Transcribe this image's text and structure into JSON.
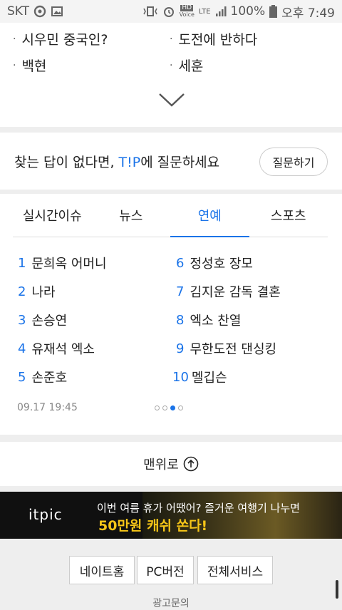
{
  "status_bar": {
    "carrier": "SKT",
    "battery": "100%",
    "time": "오후 7:49",
    "hd_label": "HD",
    "voice_label": "Voice",
    "lte_label": "LTE"
  },
  "related": {
    "items": [
      "시우민 중국인?",
      "도전에 반하다",
      "백현",
      "세훈"
    ]
  },
  "tip_prompt": {
    "prefix": "찾는 답이 없다면, ",
    "brand": "T!P",
    "suffix": "에 질문하세요",
    "button_label": "질문하기"
  },
  "trending": {
    "tabs": [
      {
        "label": "실시간이슈",
        "active": false
      },
      {
        "label": "뉴스",
        "active": false
      },
      {
        "label": "연예",
        "active": true
      },
      {
        "label": "스포츠",
        "active": false
      }
    ],
    "items": [
      {
        "rank": "1",
        "text": "문희옥 어머니"
      },
      {
        "rank": "2",
        "text": "나라"
      },
      {
        "rank": "3",
        "text": "손승연"
      },
      {
        "rank": "4",
        "text": "유재석 엑소"
      },
      {
        "rank": "5",
        "text": "손준호"
      },
      {
        "rank": "6",
        "text": "정성호 장모"
      },
      {
        "rank": "7",
        "text": "김지운 감독 결혼"
      },
      {
        "rank": "8",
        "text": "엑소 찬열"
      },
      {
        "rank": "9",
        "text": "무한도전 댄싱킹"
      },
      {
        "rank": "10",
        "text": "멜깁슨"
      }
    ],
    "timestamp": "09.17 19:45",
    "pages_total": 4,
    "page_current": 3
  },
  "back_to_top": {
    "label": "맨위로"
  },
  "banner": {
    "logo": "itpic",
    "line1": "이번 여름 휴가 어땠어? 즐거운 여행기 나누면",
    "line2": "50만원 캐쉬 쏜다!"
  },
  "footer": {
    "buttons": [
      "네이트홈",
      "PC버전",
      "전체서비스"
    ],
    "ad_label": "광고문의"
  },
  "colors": {
    "accent": "#1a73e8",
    "banner_highlight": "#f5c518"
  }
}
